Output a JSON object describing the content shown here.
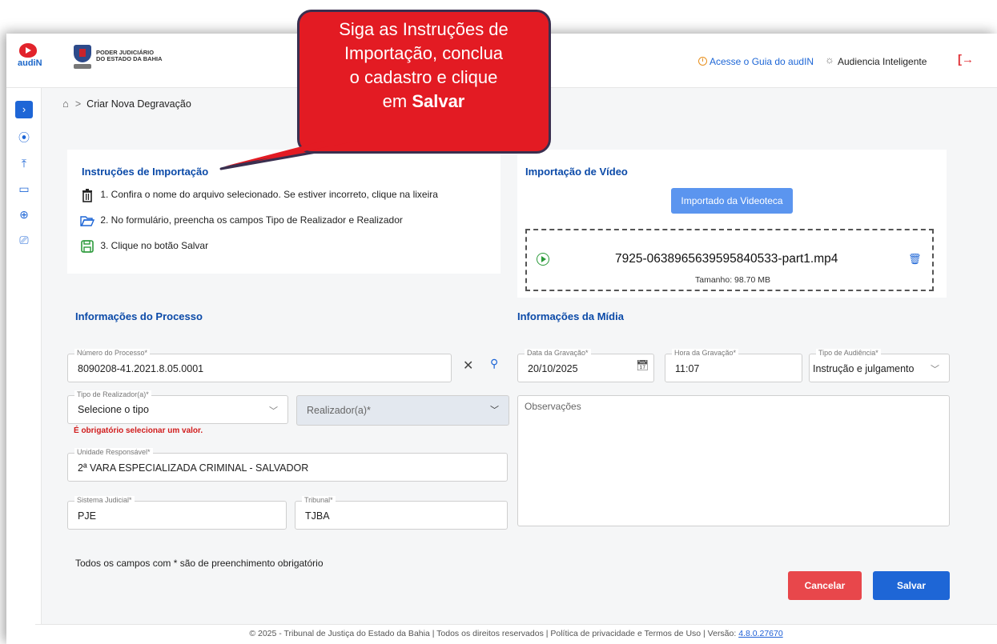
{
  "callout": {
    "line1": "Siga as Instruções de",
    "line2": "Importação, conclua",
    "line3": "o cadastro e clique",
    "line4_pre": "em ",
    "line4_bold": "Salvar"
  },
  "header": {
    "brand_line1": "PODER JUDICIÁRIO",
    "brand_line2": "DO ESTADO DA BAHIA",
    "app_logo_text": "audiN",
    "guide_link": "Acesse o Guia do audIN",
    "assistant_label": "Audiencia Inteligente"
  },
  "sidebar": {
    "toggle_icon": "chevron-right",
    "items": [
      {
        "icon": "play-circle-icon"
      },
      {
        "icon": "upload-icon"
      },
      {
        "icon": "folder-icon"
      },
      {
        "icon": "plus-circle-icon"
      },
      {
        "icon": "monitor-icon"
      }
    ]
  },
  "breadcrumb": {
    "separator": ">",
    "current": "Criar Nova Degravação"
  },
  "instructions": {
    "title": "Instruções de Importação",
    "items": [
      {
        "text": "1. Confira o nome do arquivo selecionado. Se estiver incorreto, clique na lixeira",
        "icon": "trash-icon"
      },
      {
        "text": "2. No formulário, preencha os campos Tipo de Realizador e Realizador",
        "icon": "folder-open-icon"
      },
      {
        "text": "3. Clique no botão Salvar",
        "icon": "save-icon"
      }
    ]
  },
  "video_import": {
    "title": "Importação de Vídeo",
    "import_button": "Importado da Videoteca",
    "file_name": "7925-0638965639595840533-part1.mp4",
    "file_size": "Tamanho: 98.70 MB"
  },
  "process_info": {
    "title": "Informações do Processo",
    "numero_label": "Número do Processo*",
    "numero_value": "8090208-41.2021.8.05.0001",
    "tipo_label": "Tipo de Realizador(a)*",
    "tipo_placeholder": "Selecione o tipo",
    "realizador_placeholder": "Realizador(a)*",
    "error_text": "É obrigatório selecionar um valor.",
    "unidade_label": "Unidade Responsável*",
    "unidade_value": "2ª VARA ESPECIALIZADA CRIMINAL - SALVADOR",
    "sistema_label": "Sistema Judicial*",
    "sistema_value": "PJE",
    "tribunal_label": "Tribunal*",
    "tribunal_value": "TJBA"
  },
  "media_info": {
    "title": "Informações da Mídia",
    "data_label": "Data da Gravação*",
    "data_value": "20/10/2025",
    "hora_label": "Hora da Gravação*",
    "hora_value": "11:07",
    "tipo_aud_label": "Tipo de Audiência*",
    "tipo_aud_value": "Instrução e julgamento",
    "obs_placeholder": "Observações"
  },
  "form": {
    "required_note": "Todos os campos com * são de preenchimento obrigatório",
    "cancel_label": "Cancelar",
    "save_label": "Salvar"
  },
  "footer": {
    "text": "© 2025 - Tribunal de Justiça do Estado da Bahia | Todos os direitos reservados | Política de privacidade e Termos de Uso | Versão: ",
    "version": "4.8.0.27670"
  },
  "colors": {
    "primary": "#1e66d6",
    "danger": "#e8474b",
    "callout": "#e31b23",
    "title_blue": "#0b4aa8"
  }
}
